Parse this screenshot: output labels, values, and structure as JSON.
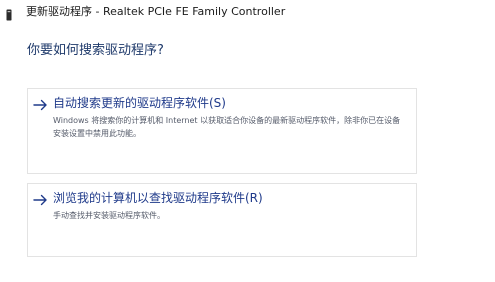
{
  "window": {
    "title": "更新驱动程序 - Realtek PCIe FE Family Controller",
    "icon": "network-adapter-icon"
  },
  "heading": "你要如何搜索驱动程序?",
  "options": [
    {
      "icon": "arrow-right-icon",
      "title": "自动搜索更新的驱动程序软件(S)",
      "description": "Windows 将搜索你的计算机和 Internet 以获取适合你设备的最新驱动程序软件，除非你已在设备安装设置中禁用此功能。"
    },
    {
      "icon": "arrow-right-icon",
      "title": "浏览我的计算机以查找驱动程序软件(R)",
      "description": "手动查找并安装驱动程序软件。"
    }
  ],
  "colors": {
    "heading": "#1f3a6b",
    "link": "#1f3a8a",
    "description": "#555b6a",
    "border": "#e3e3e3"
  }
}
